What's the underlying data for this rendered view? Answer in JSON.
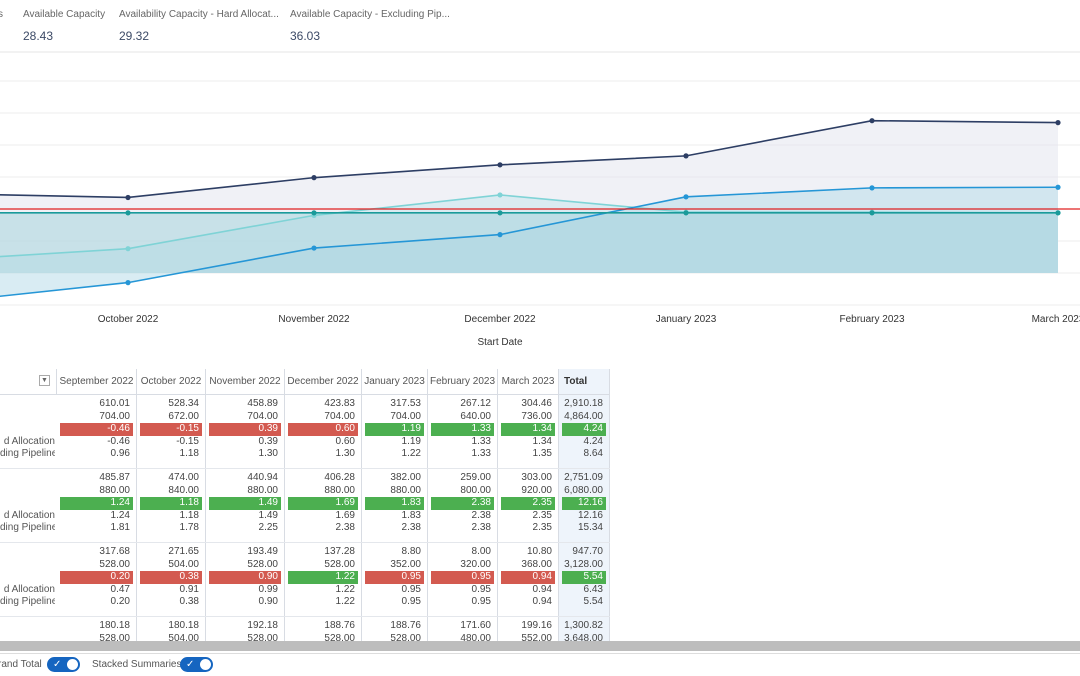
{
  "kpis": [
    {
      "label": "s",
      "value": ""
    },
    {
      "label": "Available Capacity",
      "value": "28.43"
    },
    {
      "label": "Availability Capacity - Hard Allocat...",
      "value": "29.32"
    },
    {
      "label": "Available Capacity - Excluding Pip...",
      "value": "36.03"
    }
  ],
  "chart_data": {
    "type": "area",
    "xlabel": "Start Date",
    "x": [
      "September 2022",
      "October 2022",
      "November 2022",
      "December 2022",
      "January 2023",
      "February 2023",
      "March 2023"
    ],
    "x_tick_labels": [
      "October 2022",
      "November 2022",
      "December 2022",
      "January 2023",
      "February 2023",
      "March 2023"
    ],
    "ylim": [
      -0.5,
      3.0
    ],
    "grid": true,
    "reference_line": {
      "value": 1.0,
      "color": "#e02020"
    },
    "series": [
      {
        "values": [
          1.24,
          1.18,
          1.49,
          1.69,
          1.83,
          2.38,
          2.35
        ],
        "color": "#2d3e64",
        "fill": "#e3e5ee"
      },
      {
        "values": [
          0.2,
          0.38,
          0.9,
          1.22,
          0.95,
          0.95,
          0.94
        ],
        "color": "#7fd3d6",
        "fill": "#c9e6ec"
      },
      {
        "values": [
          -0.46,
          -0.15,
          0.39,
          0.6,
          1.19,
          1.33,
          1.34
        ],
        "color": "#2596d6",
        "fill": "#b9dcea"
      },
      {
        "values": [
          0.94,
          0.94,
          0.94,
          0.94,
          0.94,
          0.94,
          0.94
        ],
        "color": "#1a9a9a",
        "fill": "#a8d3dd"
      }
    ]
  },
  "table": {
    "columns": [
      "September 2022",
      "October 2022",
      "November 2022",
      "December 2022",
      "January 2023",
      "February 2023",
      "March 2023",
      "Total"
    ],
    "groups": [
      {
        "row_labels": [
          "",
          "",
          "",
          "d Allocation",
          "ding Pipeline"
        ],
        "rows": [
          [
            "610.01",
            "528.34",
            "458.89",
            "423.83",
            "317.53",
            "267.12",
            "304.46",
            "2,910.18"
          ],
          [
            "704.00",
            "672.00",
            "704.00",
            "704.00",
            "704.00",
            "640.00",
            "736.00",
            "4,864.00"
          ],
          [
            "-0.46",
            "-0.15",
            "0.39",
            "0.60",
            "1.19",
            "1.33",
            "1.34",
            "4.24"
          ],
          [
            "-0.46",
            "-0.15",
            "0.39",
            "0.60",
            "1.19",
            "1.33",
            "1.34",
            "4.24"
          ],
          [
            "0.96",
            "1.18",
            "1.30",
            "1.30",
            "1.22",
            "1.33",
            "1.35",
            "8.64"
          ]
        ],
        "status": [
          "r",
          "r",
          "r",
          "r",
          "g",
          "g",
          "g",
          "g"
        ]
      },
      {
        "row_labels": [
          "",
          "",
          "",
          "d Allocation",
          "ding Pipeline"
        ],
        "rows": [
          [
            "485.87",
            "474.00",
            "440.94",
            "406.28",
            "382.00",
            "259.00",
            "303.00",
            "2,751.09"
          ],
          [
            "880.00",
            "840.00",
            "880.00",
            "880.00",
            "880.00",
            "800.00",
            "920.00",
            "6,080.00"
          ],
          [
            "1.24",
            "1.18",
            "1.49",
            "1.69",
            "1.83",
            "2.38",
            "2.35",
            "12.16"
          ],
          [
            "1.24",
            "1.18",
            "1.49",
            "1.69",
            "1.83",
            "2.38",
            "2.35",
            "12.16"
          ],
          [
            "1.81",
            "1.78",
            "2.25",
            "2.38",
            "2.38",
            "2.38",
            "2.35",
            "15.34"
          ]
        ],
        "status": [
          "g",
          "g",
          "g",
          "g",
          "g",
          "g",
          "g",
          "g"
        ]
      },
      {
        "row_labels": [
          "",
          "",
          "",
          "d Allocation",
          "ding Pipeline"
        ],
        "rows": [
          [
            "317.68",
            "271.65",
            "193.49",
            "137.28",
            "8.80",
            "8.00",
            "10.80",
            "947.70"
          ],
          [
            "528.00",
            "504.00",
            "528.00",
            "528.00",
            "352.00",
            "320.00",
            "368.00",
            "3,128.00"
          ],
          [
            "0.20",
            "0.38",
            "0.90",
            "1.22",
            "0.95",
            "0.95",
            "0.94",
            "5.54"
          ],
          [
            "0.47",
            "0.91",
            "0.99",
            "1.22",
            "0.95",
            "0.95",
            "0.94",
            "6.43"
          ],
          [
            "0.20",
            "0.38",
            "0.90",
            "1.22",
            "0.95",
            "0.95",
            "0.94",
            "5.54"
          ]
        ],
        "status": [
          "r",
          "r",
          "r",
          "g",
          "r",
          "r",
          "r",
          "g"
        ]
      },
      {
        "row_labels": [
          "",
          ""
        ],
        "rows": [
          [
            "180.18",
            "180.18",
            "192.18",
            "188.76",
            "188.76",
            "171.60",
            "199.16",
            "1,300.82"
          ],
          [
            "528.00",
            "504.00",
            "528.00",
            "528.00",
            "528.00",
            "480.00",
            "552.00",
            "3,648.00"
          ]
        ],
        "status": []
      }
    ]
  },
  "footer": {
    "grand_total_label": "rand Total",
    "grand_total_on": true,
    "stacked_label": "Stacked Summaries",
    "stacked_on": true
  }
}
